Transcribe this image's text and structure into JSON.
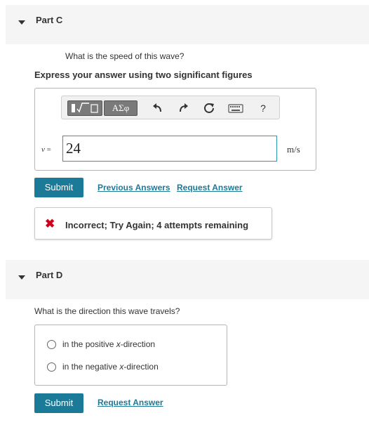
{
  "part_c": {
    "title": "Part C",
    "question": "What is the speed of this wave?",
    "instructions": "Express your answer using two significant figures",
    "toolbar": {
      "template_button": "▮√▯",
      "greek_button": "ΑΣφ",
      "icons": [
        "undo-icon",
        "redo-icon",
        "reset-icon",
        "keyboard-icon",
        "help-icon"
      ],
      "help_label": "?"
    },
    "variable": "v",
    "equals": "=",
    "answer_value": "24",
    "unit": "m/s",
    "submit_label": "Submit",
    "previous_answers_label": "Previous Answers",
    "request_answer_label": "Request Answer",
    "feedback": {
      "status": "incorrect",
      "message": "Incorrect; Try Again; 4 attempts remaining",
      "color": "#d0021b"
    }
  },
  "part_d": {
    "title": "Part D",
    "question": "What is the direction this wave travels?",
    "options": [
      {
        "prefix": "in the positive ",
        "var": "x",
        "suffix": "-direction",
        "selected": false
      },
      {
        "prefix": "in the negative ",
        "var": "x",
        "suffix": "-direction",
        "selected": false
      }
    ],
    "submit_label": "Submit",
    "request_answer_label": "Request Answer"
  },
  "colors": {
    "accent": "#1c7a99",
    "input_border": "#2a9bb0",
    "header_bg": "#f5f5f5"
  }
}
